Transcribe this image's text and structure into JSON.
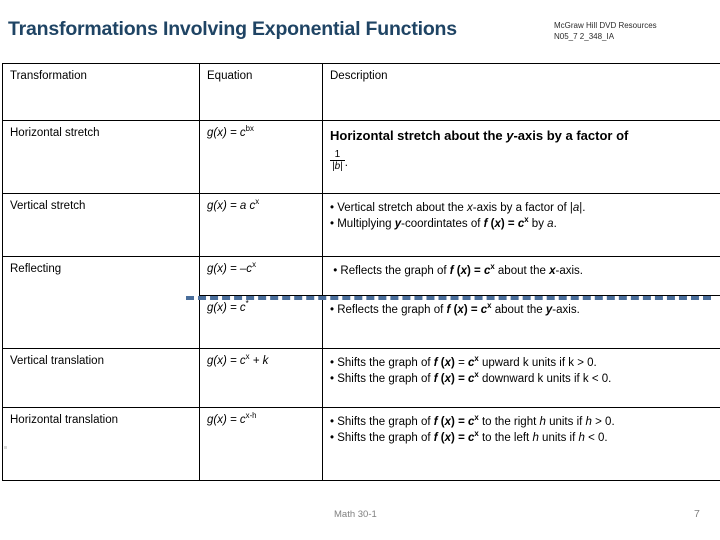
{
  "header": {
    "title": "Transformations Involving Exponential Functions",
    "source_line1": "McGraw Hill DVD Resources",
    "source_line2": "N05_7 2_348_IA"
  },
  "table": {
    "columns": [
      "Transformation",
      "Equation",
      "Description"
    ],
    "rows": [
      {
        "transformation": "Horizontal stretch",
        "equation_text": "g(x) = c",
        "equation_exponent": "bx",
        "description_main": "Horizontal stretch about the y-axis by a factor of",
        "fraction_numerator": "1",
        "fraction_denominator": "|b|",
        "fraction_trailing": "."
      },
      {
        "transformation": "Vertical stretch",
        "equation_text": "g(x) = a c",
        "equation_exponent": "x",
        "bullet1": "• Vertical stretch about the x-axis by a factor of |a|.",
        "bullet2": "• Multiplying y-coordintates of f (x) = c x by a."
      },
      {
        "transformation": "Reflecting",
        "equation_text": "g(x) = –c",
        "equation_exponent": "x",
        "bullet1": "• Reflects the graph of f (x) = c x about the x-axis."
      },
      {
        "transformation": "",
        "equation_text": "g(x) = c",
        "equation_exponent": "*",
        "bullet1": "• Reflects the graph of f (x) = c x about the y-axis."
      },
      {
        "transformation": "Vertical translation",
        "equation_text": "g(x) = c",
        "equation_exponent": "x",
        "equation_suffix": " + k",
        "bullet1": "• Shifts the graph of f (x) = c x upward k units if k > 0.",
        "bullet2": "• Shifts the graph of f (x) = c x downward k units if k < 0."
      },
      {
        "transformation": "Horizontal translation",
        "equation_text": "g(x) = c",
        "equation_exponent": "x-h",
        "bullet1": "• Shifts the graph of f (x) = c x to the right h units if h > 0.",
        "bullet2": "• Shifts the graph of f (x) = c x to the left h units if h < 0."
      }
    ]
  },
  "footer": {
    "course": "Math 30-1",
    "page": "7"
  },
  "colors": {
    "title": "#1F4464",
    "header_text": "#1F3864",
    "transformation_text": "#C0504D",
    "dashed_separator": "#4A6E9B",
    "footer_text": "#808080",
    "border": "#000000"
  }
}
